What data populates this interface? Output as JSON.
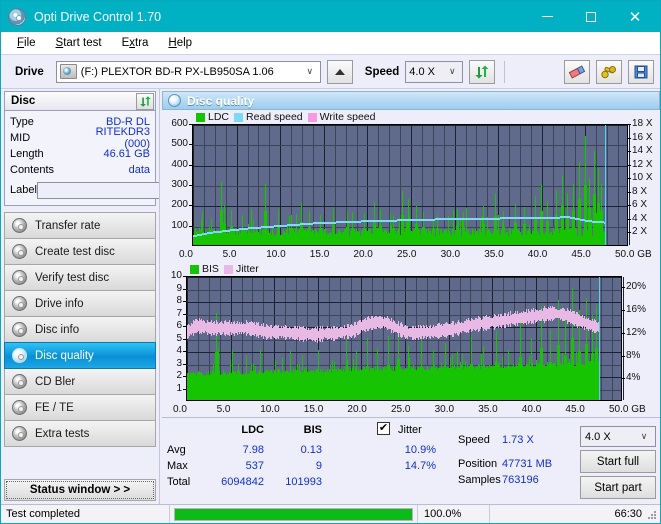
{
  "window": {
    "title": "Opti Drive Control 1.70",
    "icon": "disc-icon",
    "minimize": "–",
    "maximize": "□",
    "close": "✕",
    "titlebar_color": "#00b1c4"
  },
  "menu": {
    "items": [
      {
        "label": "File",
        "mnemonic": "F"
      },
      {
        "label": "Start test",
        "mnemonic": "S"
      },
      {
        "label": "Extra",
        "mnemonic": "x"
      },
      {
        "label": "Help",
        "mnemonic": "H"
      }
    ]
  },
  "toolbar": {
    "drive_label": "Drive",
    "drive_value": "(F:)  PLEXTOR BD-R  PX-LB950SA 1.06",
    "drive_icon": "drive-icon",
    "eject_icon": "eject-icon",
    "speed_label": "Speed",
    "speed_value": "4.0 X",
    "refresh_icon": "refresh-icon",
    "eraser_icon": "eraser-icon",
    "tools_icon": "tools-icon",
    "save_icon": "save-icon",
    "chevron": "∨"
  },
  "disc_panel": {
    "header": "Disc",
    "refresh_icon": "refresh-icon",
    "rows": [
      {
        "key": "Type",
        "value": "BD-R DL"
      },
      {
        "key": "MID",
        "value": "RITEKDR3 (000)"
      },
      {
        "key": "Length",
        "value": "46.61 GB"
      },
      {
        "key": "Contents",
        "value": "data"
      }
    ],
    "label_key": "Label",
    "label_value": "",
    "label_placeholder": "",
    "label_icon": "disc-icon"
  },
  "sidebar": {
    "items": [
      {
        "label": "Transfer rate",
        "selected": false
      },
      {
        "label": "Create test disc",
        "selected": false
      },
      {
        "label": "Verify test disc",
        "selected": false
      },
      {
        "label": "Drive info",
        "selected": false
      },
      {
        "label": "Disc info",
        "selected": false
      },
      {
        "label": "Disc quality",
        "selected": true
      },
      {
        "label": "CD Bler",
        "selected": false
      },
      {
        "label": "FE / TE",
        "selected": false
      },
      {
        "label": "Extra tests",
        "selected": false
      }
    ],
    "status_window_button": "Status window > >"
  },
  "content": {
    "header": "Disc quality",
    "header_icon": "disc-quality-icon"
  },
  "chart_data": [
    {
      "type": "line",
      "title": "LDC / Read speed",
      "xlabel": "GB",
      "ylabel": "LDC",
      "xlim": [
        0,
        50
      ],
      "ylim": [
        0,
        600
      ],
      "xticks": [
        "0.0",
        "5.0",
        "10.0",
        "15.0",
        "20.0",
        "25.0",
        "30.0",
        "35.0",
        "40.0",
        "45.0",
        "50.0 GB"
      ],
      "yticks": [
        "100",
        "200",
        "300",
        "400",
        "500",
        "600"
      ],
      "y2label": "Speed",
      "y2lim": [
        0,
        18
      ],
      "y2ticks": [
        "2 X",
        "4 X",
        "6 X",
        "8 X",
        "10 X",
        "12 X",
        "14 X",
        "16 X",
        "18 X"
      ],
      "grid": true,
      "legend_position": "top-left",
      "legend": [
        {
          "name": "LDC",
          "color": "#16c402"
        },
        {
          "name": "Read speed",
          "color": "#7fd8f6"
        },
        {
          "name": "Write speed",
          "color": "#f49ae0"
        }
      ],
      "series": [
        {
          "name": "LDC",
          "color": "#16c402",
          "render": "bars",
          "noise_floor": 45,
          "noise_span": 40,
          "spikes": [
            {
              "x": 3.2,
              "y": 310
            },
            {
              "x": 3.6,
              "y": 195
            },
            {
              "x": 4.4,
              "y": 170
            },
            {
              "x": 5.6,
              "y": 150
            },
            {
              "x": 8.2,
              "y": 302
            },
            {
              "x": 9.8,
              "y": 175
            },
            {
              "x": 11.2,
              "y": 150
            },
            {
              "x": 12.4,
              "y": 205
            },
            {
              "x": 13.3,
              "y": 165
            },
            {
              "x": 14.6,
              "y": 150
            },
            {
              "x": 16.0,
              "y": 175
            },
            {
              "x": 17.7,
              "y": 160
            },
            {
              "x": 19.6,
              "y": 155
            },
            {
              "x": 20.8,
              "y": 210
            },
            {
              "x": 21.4,
              "y": 175
            },
            {
              "x": 22.9,
              "y": 150
            },
            {
              "x": 24.0,
              "y": 265
            },
            {
              "x": 24.6,
              "y": 225
            },
            {
              "x": 25.6,
              "y": 190
            },
            {
              "x": 26.4,
              "y": 160
            },
            {
              "x": 28.0,
              "y": 150
            },
            {
              "x": 30.3,
              "y": 175
            },
            {
              "x": 31.0,
              "y": 160
            },
            {
              "x": 33.2,
              "y": 190
            },
            {
              "x": 34.6,
              "y": 255
            },
            {
              "x": 35.6,
              "y": 165
            },
            {
              "x": 36.9,
              "y": 200
            },
            {
              "x": 38.0,
              "y": 185
            },
            {
              "x": 39.2,
              "y": 240
            },
            {
              "x": 39.9,
              "y": 300
            },
            {
              "x": 40.6,
              "y": 215
            },
            {
              "x": 41.6,
              "y": 270
            },
            {
              "x": 42.3,
              "y": 345
            },
            {
              "x": 42.9,
              "y": 255
            },
            {
              "x": 43.6,
              "y": 300
            },
            {
              "x": 44.3,
              "y": 410
            },
            {
              "x": 44.9,
              "y": 537
            },
            {
              "x": 45.4,
              "y": 330
            },
            {
              "x": 46.0,
              "y": 460
            },
            {
              "x": 46.4,
              "y": 380
            },
            {
              "x": 46.8,
              "y": 300
            }
          ]
        },
        {
          "name": "Read speed",
          "color": "#7fd8f6",
          "render": "line",
          "points": [
            {
              "x": 0.0,
              "y": 1.6
            },
            {
              "x": 2.0,
              "y": 2.1
            },
            {
              "x": 4.0,
              "y": 2.4
            },
            {
              "x": 6.0,
              "y": 2.7
            },
            {
              "x": 8.0,
              "y": 2.9
            },
            {
              "x": 10.0,
              "y": 3.1
            },
            {
              "x": 12.0,
              "y": 3.3
            },
            {
              "x": 14.0,
              "y": 3.5
            },
            {
              "x": 16.0,
              "y": 3.6
            },
            {
              "x": 18.0,
              "y": 3.7
            },
            {
              "x": 20.0,
              "y": 3.8
            },
            {
              "x": 23.0,
              "y": 3.9
            },
            {
              "x": 26.0,
              "y": 4.0
            },
            {
              "x": 29.0,
              "y": 4.1
            },
            {
              "x": 32.0,
              "y": 4.2
            },
            {
              "x": 35.0,
              "y": 4.2
            },
            {
              "x": 38.0,
              "y": 4.3
            },
            {
              "x": 41.0,
              "y": 4.3
            },
            {
              "x": 43.0,
              "y": 4.4
            },
            {
              "x": 44.5,
              "y": 4.0
            },
            {
              "x": 46.0,
              "y": 3.7
            },
            {
              "x": 47.2,
              "y": 3.6
            }
          ]
        }
      ],
      "end_marker_x": 47.2
    },
    {
      "type": "line",
      "title": "BIS / Jitter",
      "xlabel": "GB",
      "ylabel": "BIS",
      "xlim": [
        0,
        50
      ],
      "ylim": [
        0,
        10
      ],
      "xticks": [
        "0.0",
        "5.0",
        "10.0",
        "15.0",
        "20.0",
        "25.0",
        "30.0",
        "35.0",
        "40.0",
        "45.0",
        "50.0 GB"
      ],
      "yticks": [
        "1",
        "2",
        "3",
        "4",
        "5",
        "6",
        "7",
        "8",
        "9",
        "10"
      ],
      "y2label": "Jitter",
      "y2lim": [
        0,
        22
      ],
      "y2ticks": [
        "4%",
        "8%",
        "12%",
        "16%",
        "20%"
      ],
      "grid": true,
      "legend_position": "top-left",
      "legend": [
        {
          "name": "BIS",
          "color": "#16c402"
        },
        {
          "name": "Jitter",
          "color": "#e8b9e4"
        }
      ],
      "series": [
        {
          "name": "BIS",
          "color": "#16c402",
          "render": "bars",
          "noise_floor": 1.9,
          "noise_span": 0.4,
          "spikes": [
            {
              "x": 3.3,
              "y": 7.0
            },
            {
              "x": 3.6,
              "y": 4.2
            },
            {
              "x": 5.2,
              "y": 4.0
            },
            {
              "x": 6.8,
              "y": 3.5
            },
            {
              "x": 8.4,
              "y": 4.1
            },
            {
              "x": 10.1,
              "y": 3.2
            },
            {
              "x": 11.8,
              "y": 4.0
            },
            {
              "x": 13.2,
              "y": 3.4
            },
            {
              "x": 15.0,
              "y": 4.0
            },
            {
              "x": 16.6,
              "y": 3.2
            },
            {
              "x": 18.2,
              "y": 4.9
            },
            {
              "x": 19.4,
              "y": 4.0
            },
            {
              "x": 20.6,
              "y": 5.0
            },
            {
              "x": 21.8,
              "y": 4.2
            },
            {
              "x": 23.0,
              "y": 5.1
            },
            {
              "x": 24.2,
              "y": 6.0
            },
            {
              "x": 25.4,
              "y": 4.4
            },
            {
              "x": 26.8,
              "y": 5.0
            },
            {
              "x": 28.2,
              "y": 4.0
            },
            {
              "x": 29.6,
              "y": 4.6
            },
            {
              "x": 31.0,
              "y": 3.9
            },
            {
              "x": 32.6,
              "y": 5.2
            },
            {
              "x": 34.0,
              "y": 4.3
            },
            {
              "x": 35.4,
              "y": 5.5
            },
            {
              "x": 36.8,
              "y": 4.0
            },
            {
              "x": 38.2,
              "y": 6.2
            },
            {
              "x": 39.4,
              "y": 5.0
            },
            {
              "x": 40.6,
              "y": 7.5
            },
            {
              "x": 41.6,
              "y": 5.6
            },
            {
              "x": 42.6,
              "y": 8.0
            },
            {
              "x": 43.4,
              "y": 6.4
            },
            {
              "x": 44.2,
              "y": 9.0
            },
            {
              "x": 45.0,
              "y": 7.2
            },
            {
              "x": 45.8,
              "y": 8.2
            },
            {
              "x": 46.4,
              "y": 6.8
            },
            {
              "x": 46.9,
              "y": 7.6
            }
          ]
        },
        {
          "name": "Jitter",
          "color": "#e8b9e4",
          "render": "band",
          "points": [
            {
              "x": 0.0,
              "y": 5.6
            },
            {
              "x": 1.0,
              "y": 6.1
            },
            {
              "x": 2.0,
              "y": 6.0
            },
            {
              "x": 3.0,
              "y": 5.9
            },
            {
              "x": 4.0,
              "y": 5.9
            },
            {
              "x": 5.0,
              "y": 5.9
            },
            {
              "x": 6.0,
              "y": 5.9
            },
            {
              "x": 7.0,
              "y": 5.9
            },
            {
              "x": 8.0,
              "y": 5.8
            },
            {
              "x": 9.0,
              "y": 5.6
            },
            {
              "x": 10.0,
              "y": 5.6
            },
            {
              "x": 11.0,
              "y": 5.6
            },
            {
              "x": 12.0,
              "y": 5.5
            },
            {
              "x": 13.0,
              "y": 5.5
            },
            {
              "x": 14.0,
              "y": 5.4
            },
            {
              "x": 15.0,
              "y": 5.4
            },
            {
              "x": 16.0,
              "y": 5.5
            },
            {
              "x": 17.0,
              "y": 5.5
            },
            {
              "x": 18.0,
              "y": 5.6
            },
            {
              "x": 19.0,
              "y": 5.7
            },
            {
              "x": 20.0,
              "y": 6.1
            },
            {
              "x": 21.0,
              "y": 6.3
            },
            {
              "x": 22.0,
              "y": 6.4
            },
            {
              "x": 23.0,
              "y": 6.3
            },
            {
              "x": 24.0,
              "y": 5.9
            },
            {
              "x": 25.0,
              "y": 5.6
            },
            {
              "x": 26.0,
              "y": 5.5
            },
            {
              "x": 27.0,
              "y": 5.6
            },
            {
              "x": 28.0,
              "y": 5.6
            },
            {
              "x": 29.0,
              "y": 5.7
            },
            {
              "x": 30.0,
              "y": 5.8
            },
            {
              "x": 31.0,
              "y": 5.9
            },
            {
              "x": 32.0,
              "y": 6.1
            },
            {
              "x": 33.0,
              "y": 6.2
            },
            {
              "x": 34.0,
              "y": 6.3
            },
            {
              "x": 35.0,
              "y": 6.4
            },
            {
              "x": 36.0,
              "y": 6.5
            },
            {
              "x": 37.0,
              "y": 6.6
            },
            {
              "x": 38.0,
              "y": 6.7
            },
            {
              "x": 39.0,
              "y": 6.8
            },
            {
              "x": 40.0,
              "y": 6.9
            },
            {
              "x": 41.0,
              "y": 7.0
            },
            {
              "x": 42.0,
              "y": 7.1
            },
            {
              "x": 43.0,
              "y": 7.0
            },
            {
              "x": 44.0,
              "y": 6.8
            },
            {
              "x": 45.0,
              "y": 6.5
            },
            {
              "x": 46.0,
              "y": 6.2
            },
            {
              "x": 47.0,
              "y": 6.0
            }
          ]
        }
      ],
      "end_marker_x": 47.2
    }
  ],
  "stats": {
    "col_ldc": "LDC",
    "col_bis": "BIS",
    "col_jitter": "Jitter",
    "jitter_checked": true,
    "jitter_check_glyph": "✔",
    "row_avg": "Avg",
    "row_max": "Max",
    "row_total": "Total",
    "ldc_avg": "7.98",
    "ldc_max": "537",
    "ldc_total": "6094842",
    "bis_avg": "0.13",
    "bis_max": "9",
    "bis_total": "101993",
    "jitter_avg": "10.9%",
    "jitter_max": "14.7%",
    "speed_label": "Speed",
    "speed_value": "1.73 X",
    "position_label": "Position",
    "position_value": "47731 MB",
    "samples_label": "Samples",
    "samples_value": "763196",
    "speed_select": "4.0 X",
    "speed_select_chevron": "∨",
    "start_full_button": "Start full",
    "start_part_button": "Start part"
  },
  "statusbar": {
    "message": "Test completed",
    "progress_percent": "100.0%",
    "progress_value": 100,
    "elapsed": "66:30"
  }
}
